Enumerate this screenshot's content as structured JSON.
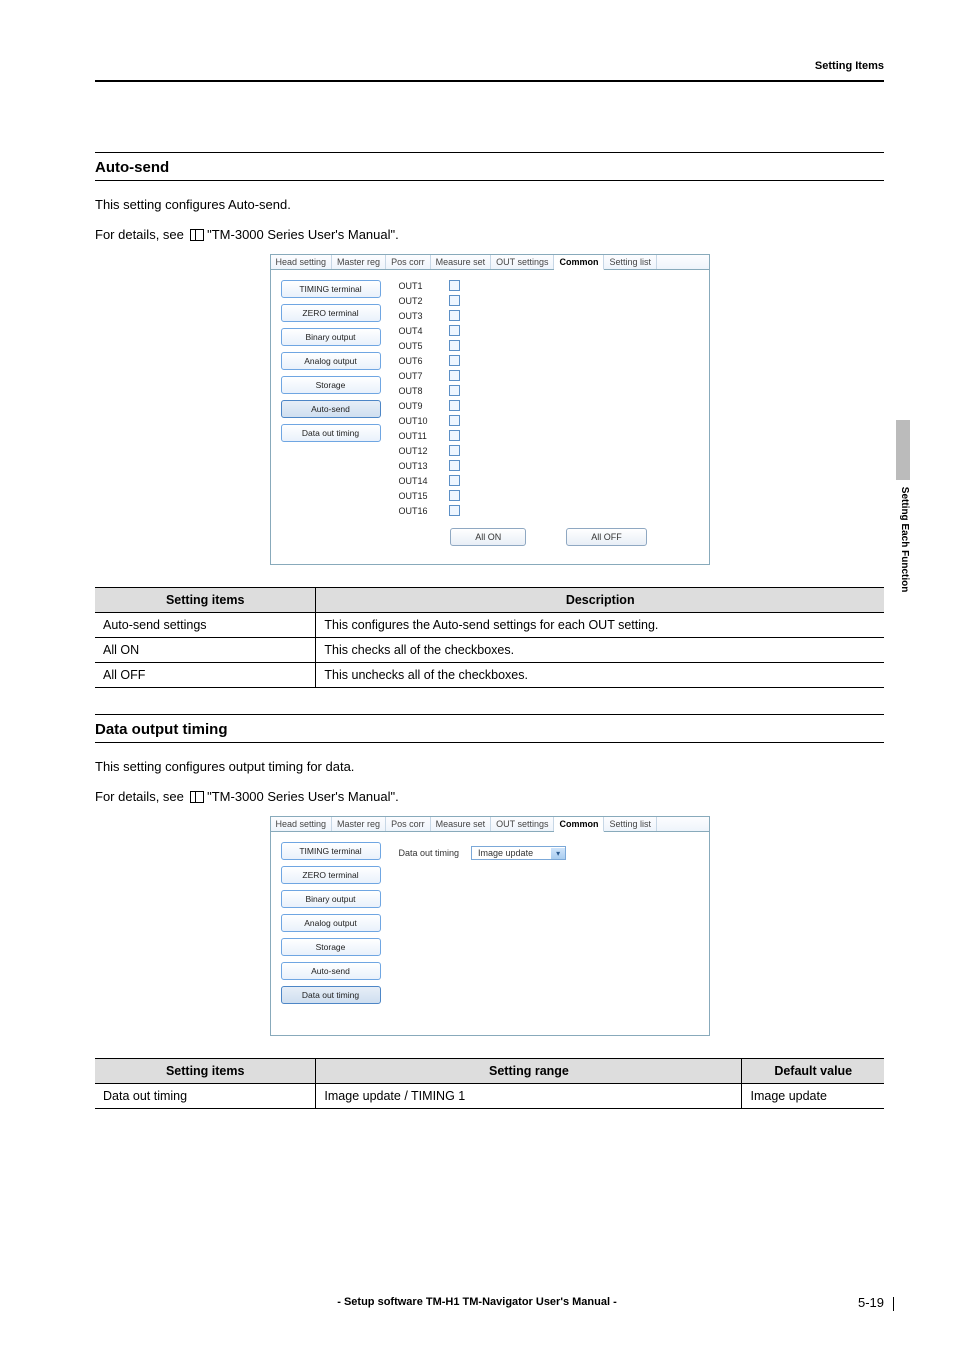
{
  "header": {
    "right": "Setting Items"
  },
  "side_label": "Setting Each Function",
  "section1": {
    "title": "Auto-send",
    "para1": "This setting configures Auto-send.",
    "para2a": "For details, see ",
    "para2b": " \"TM-3000 Series User's Manual\"."
  },
  "tabs": [
    "Head setting",
    "Master reg",
    "Pos corr",
    "Measure set",
    "OUT settings",
    "Common",
    "Setting list"
  ],
  "sidebuttons": [
    "TIMING terminal",
    "ZERO terminal",
    "Binary output",
    "Analog output",
    "Storage",
    "Auto-send",
    "Data out timing"
  ],
  "out_labels": [
    "OUT1",
    "OUT2",
    "OUT3",
    "OUT4",
    "OUT5",
    "OUT6",
    "OUT7",
    "OUT8",
    "OUT9",
    "OUT10",
    "OUT11",
    "OUT12",
    "OUT13",
    "OUT14",
    "OUT15",
    "OUT16"
  ],
  "allon": "All ON",
  "alloff": "All OFF",
  "table1": {
    "h1": "Setting items",
    "h2": "Description",
    "rows": [
      [
        "Auto-send settings",
        "This configures the Auto-send settings for each OUT setting."
      ],
      [
        "All ON",
        "This checks all of the checkboxes."
      ],
      [
        "All OFF",
        "This unchecks all of the checkboxes."
      ]
    ]
  },
  "section2": {
    "title": "Data output timing",
    "para1": "This setting configures output timing for data.",
    "para2a": "For details, see ",
    "para2b": " \"TM-3000 Series User's Manual\"."
  },
  "dot_label": "Data out timing",
  "dot_value": "Image update",
  "table2": {
    "h1": "Setting items",
    "h2": "Setting range",
    "h3": "Default value",
    "rows": [
      [
        "Data out timing",
        "Image update / TIMING 1",
        "Image update"
      ]
    ]
  },
  "footer": "- Setup software TM-H1 TM-Navigator User's Manual -",
  "pagenum": "5-19",
  "chart_data": {
    "type": "table",
    "title": "Auto-send / Data output timing settings",
    "tables": [
      {
        "columns": [
          "Setting items",
          "Description"
        ],
        "rows": [
          [
            "Auto-send settings",
            "This configures the Auto-send settings for each OUT setting."
          ],
          [
            "All ON",
            "This checks all of the checkboxes."
          ],
          [
            "All OFF",
            "This unchecks all of the checkboxes."
          ]
        ]
      },
      {
        "columns": [
          "Setting items",
          "Setting range",
          "Default value"
        ],
        "rows": [
          [
            "Data out timing",
            "Image update / TIMING 1",
            "Image update"
          ]
        ]
      }
    ]
  }
}
